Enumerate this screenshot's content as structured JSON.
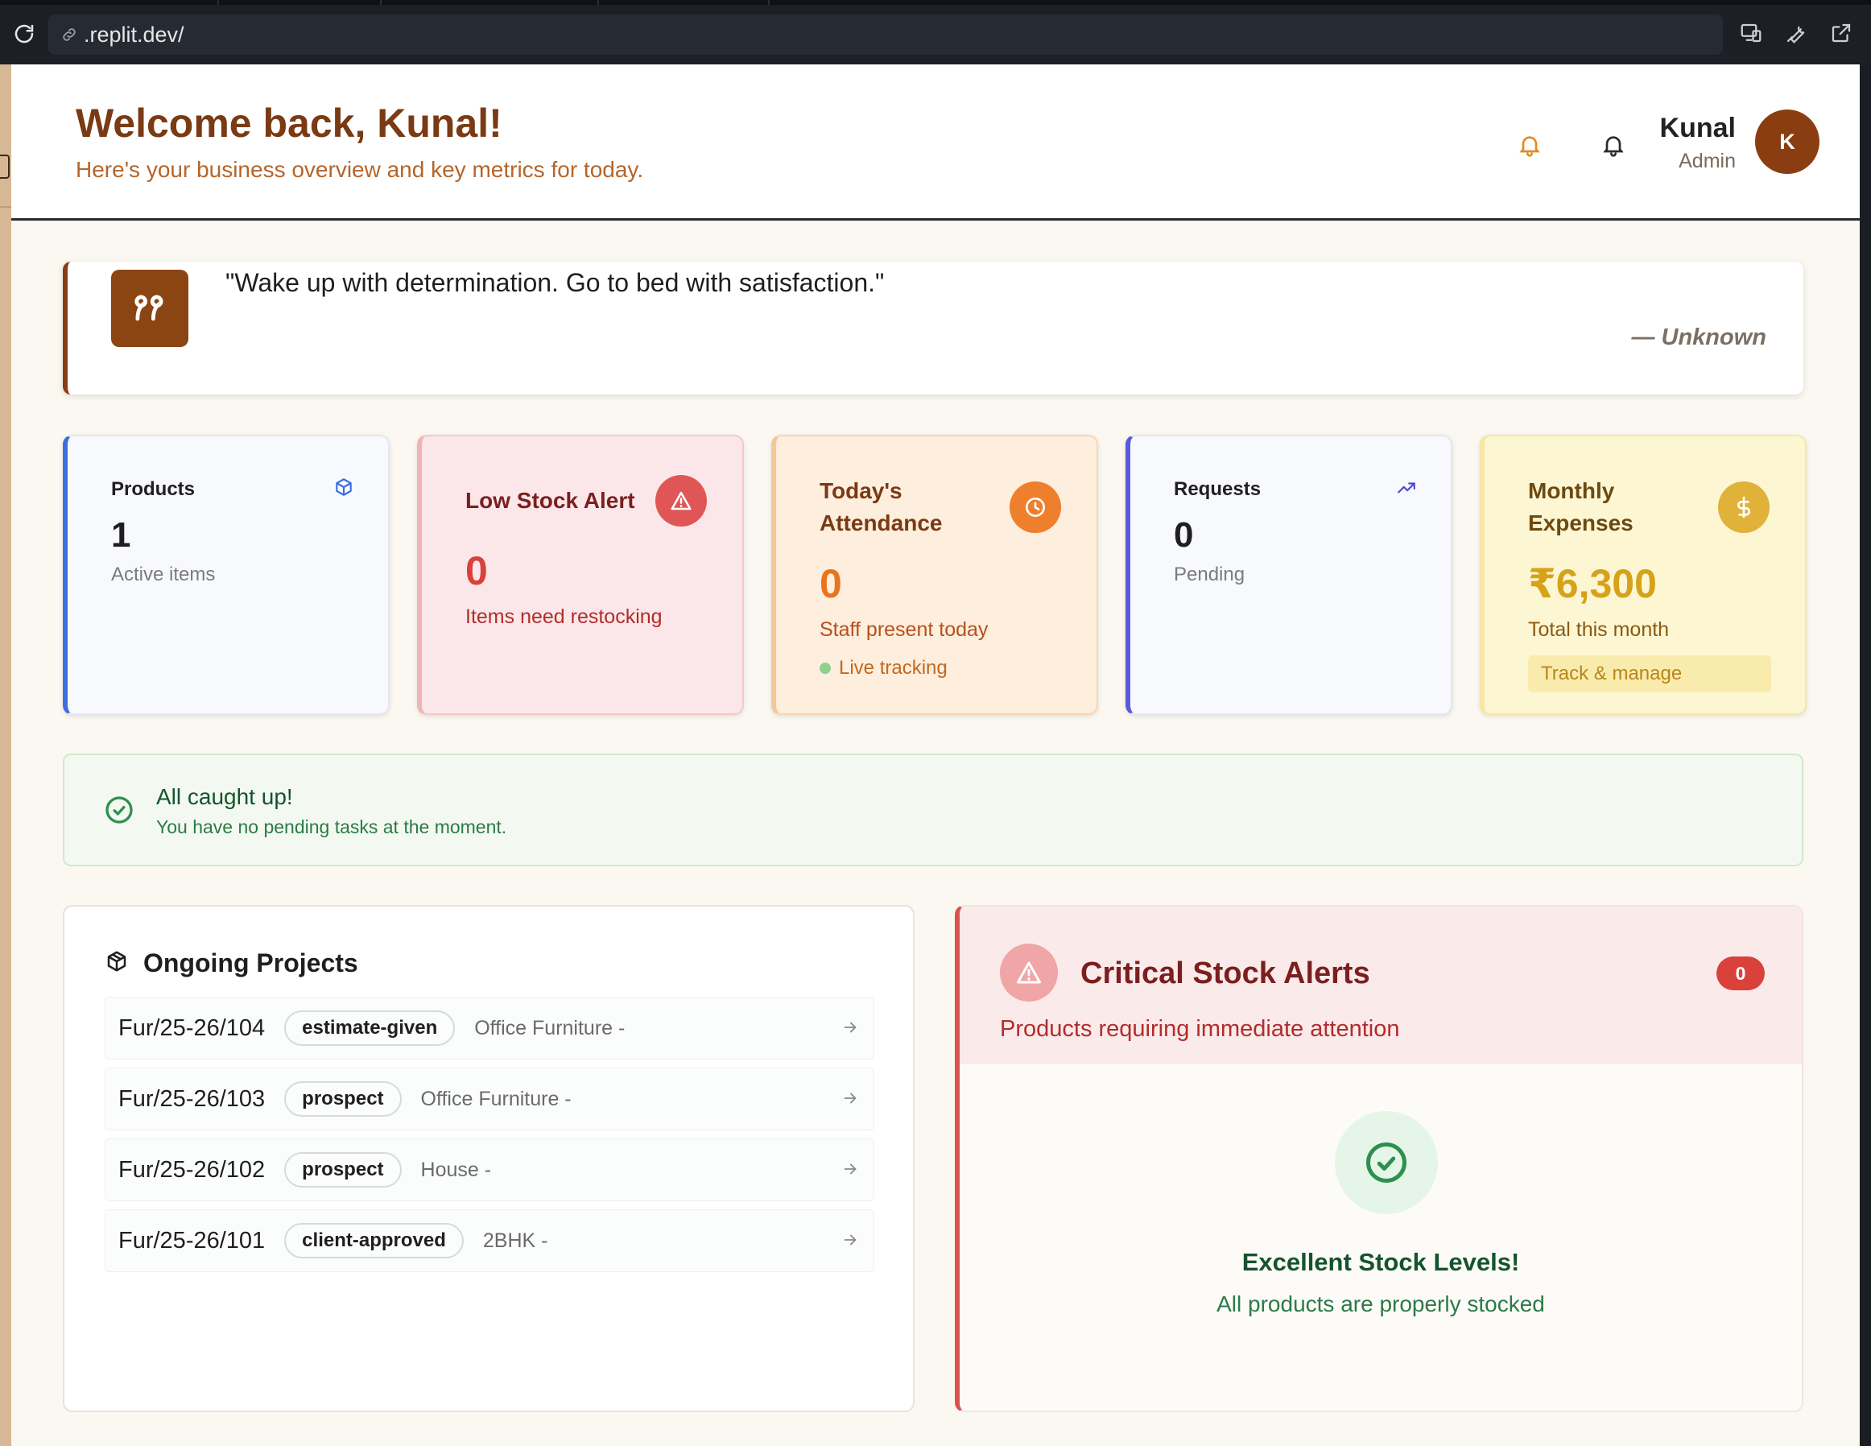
{
  "browser": {
    "url": ".replit.dev/"
  },
  "header": {
    "title": "Welcome back, Kunal!",
    "subtitle": "Here's your business overview and key metrics for today.",
    "user_name": "Kunal",
    "user_role": "Admin",
    "avatar_initial": "K"
  },
  "quote": {
    "text": "\"Wake up with determination. Go to bed with satisfaction.\"",
    "author": "— Unknown"
  },
  "stats": {
    "products": {
      "title": "Products",
      "value": "1",
      "sub": "Active items",
      "accent": "#3b6fe0",
      "icon": "cube-icon"
    },
    "low_stock": {
      "title": "Low Stock Alert",
      "value": "0",
      "sub": "Items need restocking",
      "accent": "#e36464",
      "icon": "alert-triangle-icon"
    },
    "attendance": {
      "title_line1": "Today's",
      "title_line2": "Attendance",
      "value": "0",
      "sub": "Staff present today",
      "live": "Live tracking",
      "accent": "#ee7f2d",
      "icon": "clock-icon"
    },
    "requests": {
      "title": "Requests",
      "value": "0",
      "sub": "Pending",
      "accent": "#5b5bd6",
      "icon": "trending-up-icon"
    },
    "expenses": {
      "title_line1": "Monthly",
      "title_line2": "Expenses",
      "value": "₹6,300",
      "sub": "Total this month",
      "action": "Track & manage",
      "accent": "#e0b23a",
      "icon": "dollar-icon"
    }
  },
  "caught_up": {
    "title": "All caught up!",
    "subtitle": "You have no pending tasks at the moment."
  },
  "projects": {
    "title": "Ongoing Projects",
    "rows": [
      {
        "id": "Fur/25-26/104",
        "status": "estimate-given",
        "type": "Office Furniture -"
      },
      {
        "id": "Fur/25-26/103",
        "status": "prospect",
        "type": "Office Furniture -"
      },
      {
        "id": "Fur/25-26/102",
        "status": "prospect",
        "type": "House -"
      },
      {
        "id": "Fur/25-26/101",
        "status": "client-approved",
        "type": "2BHK -"
      }
    ]
  },
  "critical": {
    "title": "Critical Stock Alerts",
    "subtitle": "Products requiring immediate attention",
    "count": "0",
    "ok_title": "Excellent Stock Levels!",
    "ok_subtitle": "All products are properly stocked"
  }
}
